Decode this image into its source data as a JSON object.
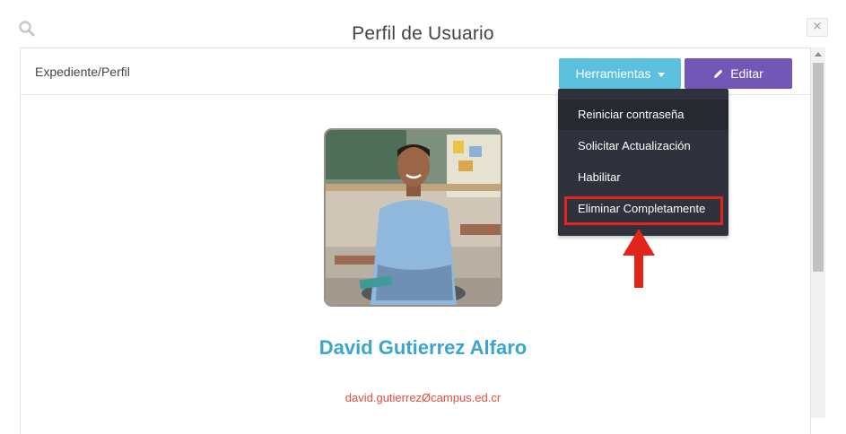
{
  "modal": {
    "title": "Perfil de Usuario",
    "close_glyph": "×"
  },
  "header": {
    "breadcrumb": "Expediente/Perfil",
    "tools_label": "Herramientas",
    "edit_label": "Editar"
  },
  "dropdown": {
    "items": [
      {
        "label": "Reiniciar contraseña"
      },
      {
        "label": "Solicitar Actualización"
      },
      {
        "label": "Habilitar"
      },
      {
        "label": "Eliminar Completamente"
      }
    ],
    "highlighted_index": 3
  },
  "profile": {
    "name": "David Gutierrez Alfaro",
    "email": "david.gutierrezØcampus.ed.cr"
  },
  "colors": {
    "tools_button": "#5bc0de",
    "edit_button": "#7357b6",
    "dropdown_bg": "#2f323c",
    "highlight": "#e1251b",
    "name": "#3aa6d0",
    "email": "#e74c3c"
  },
  "icons": [
    "search-icon",
    "close-icon",
    "caret-down-icon",
    "pencil-icon",
    "arrow-up-icon"
  ]
}
